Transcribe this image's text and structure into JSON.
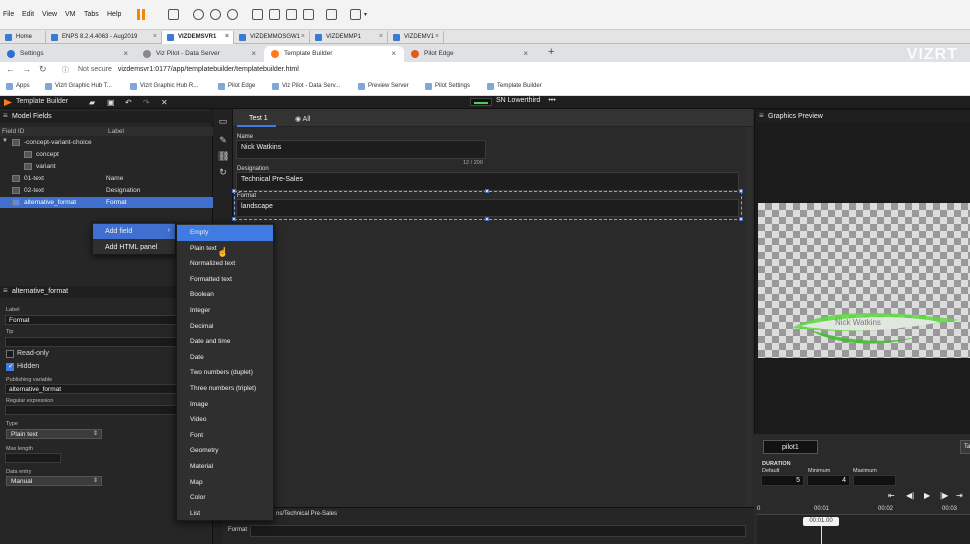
{
  "vm_menu": [
    "File",
    "Edit",
    "View",
    "VM",
    "Tabs",
    "Help"
  ],
  "vm_tabs": [
    {
      "label": "Home",
      "active": false
    },
    {
      "label": "ENPS 8.2.4.4063 - Aug2019",
      "active": false
    },
    {
      "label": "VIZDEMSVR1",
      "active": true
    },
    {
      "label": "VIZDEMMOSGW1",
      "active": false
    },
    {
      "label": "VIZDEMMP1",
      "active": false
    },
    {
      "label": "VIZDEMV1",
      "active": false
    }
  ],
  "browser_tabs": [
    {
      "label": "Settings",
      "active": false
    },
    {
      "label": "Viz Pilot - Data Server",
      "active": false
    },
    {
      "label": "Template Builder",
      "active": true
    },
    {
      "label": "Pilot Edge",
      "active": false
    }
  ],
  "address": {
    "not_secure": "Not secure",
    "url": "vizdemsvr1:0177/app/templatebuilder/templatebuilder.html"
  },
  "bookmarks": [
    "Apps",
    "Vizrt Graphic Hub T...",
    "Vizrt Graphic Hub R...",
    "Pilot Edge",
    "Viz Pilot - Data Serv...",
    "Preview Server",
    "Pilot Settings",
    "Template Builder"
  ],
  "watermark": "VIZRT",
  "app": {
    "title": "Template Builder",
    "template_name": "SN Lowerthird"
  },
  "model_fields": {
    "header": "Model Fields",
    "col_field_id": "Field ID",
    "col_label": "Label",
    "rows": [
      {
        "id": "-concept-variant-choice",
        "label": "",
        "indent": 0
      },
      {
        "id": "concept",
        "label": "",
        "indent": 1
      },
      {
        "id": "variant",
        "label": "",
        "indent": 1
      },
      {
        "id": "01-text",
        "label": "Name",
        "indent": 0
      },
      {
        "id": "02-text",
        "label": "Designation",
        "indent": 0
      },
      {
        "id": "alternative_format",
        "label": "Format",
        "indent": 0,
        "selected": true
      }
    ]
  },
  "context_menu": {
    "add_field": "Add field",
    "add_html_panel": "Add HTML panel"
  },
  "field_types": [
    "Empty",
    "Plain text",
    "Normalized text",
    "Formatted text",
    "Boolean",
    "Integer",
    "Decimal",
    "Date and time",
    "Date",
    "Two numbers (duplet)",
    "Three numbers (triplet)",
    "Image",
    "Video",
    "Font",
    "Geometry",
    "Material",
    "Map",
    "Color",
    "List"
  ],
  "properties": {
    "header": "alternative_format",
    "label_caption": "Label",
    "label_value": "Format",
    "tip_caption": "Tip",
    "tip_value": "",
    "read_only": "Read-only",
    "read_only_checked": false,
    "hidden": "Hidden",
    "hidden_checked": true,
    "publishing_variable_caption": "Publishing variable",
    "publishing_variable_value": "alternative_format",
    "regex_caption": "Regular expression",
    "regex_value": "",
    "type_caption": "Type",
    "type_value": "Plain text",
    "max_length_caption": "Max length",
    "max_length_value": "",
    "data_entry_caption": "Data entry",
    "data_entry_value": "Manual"
  },
  "center": {
    "tab_test": "Test 1",
    "tab_all": "All",
    "name_label": "Name",
    "name_value": "Nick Watkins",
    "name_counter": "12 / 200",
    "designation_label": "Designation",
    "designation_value": "Technical Pre-Sales",
    "format_label": "Format",
    "format_value": "landscape",
    "bottom_path": "ns/Technical Pre-Sales",
    "bottom_format_label": "Format"
  },
  "preview": {
    "header": "Graphics Preview",
    "overlay_name": "Nick Watkins",
    "channel": "pilot1",
    "duration_caption": "DURATION",
    "default_caption": "Default",
    "default_value": "5",
    "minimum_caption": "Minimum",
    "minimum_value": "4",
    "maximum_caption": "Maximum",
    "maximum_value": "",
    "timeline": [
      "0",
      "00:01",
      "00:02",
      "00:03"
    ],
    "current_time": "00:01.00",
    "accent": "#4ad24a"
  },
  "colors": {
    "selection": "#3f6fcf",
    "accent_orange": "#ff7a1a"
  }
}
